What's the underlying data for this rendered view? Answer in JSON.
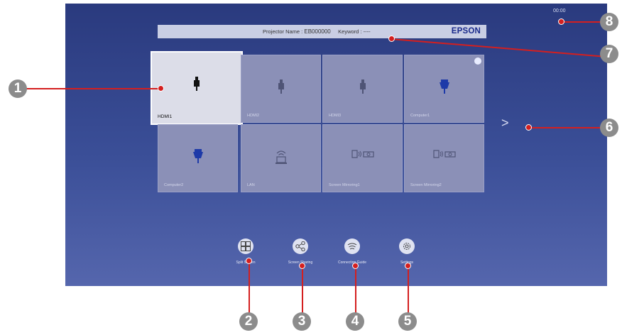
{
  "header": {
    "clock": "00:00",
    "projector_label": "Projector Name :",
    "projector_name": "EB000000",
    "keyword_label": "Keyword :",
    "keyword_value": "----",
    "brand": "EPSON"
  },
  "sources": [
    {
      "label": "HDMI1",
      "icon": "hdmi-icon",
      "selected": true
    },
    {
      "label": "HDMI2",
      "icon": "hdmi-icon"
    },
    {
      "label": "HDMI3",
      "icon": "hdmi-icon"
    },
    {
      "label": "Computer1",
      "icon": "vga-icon",
      "checked": true
    },
    {
      "label": "Computer2",
      "icon": "vga-icon"
    },
    {
      "label": "LAN",
      "icon": "lan-icon"
    },
    {
      "label": "Screen Mirroring1",
      "icon": "mirroring-icon"
    },
    {
      "label": "Screen Mirroring2",
      "icon": "mirroring-icon"
    }
  ],
  "next_arrow": ">",
  "bottom_buttons": [
    {
      "label": "Split Screen",
      "icon": "split-screen-icon"
    },
    {
      "label": "Screen Sharing",
      "icon": "share-icon"
    },
    {
      "label": "Connection Guide",
      "icon": "wifi-icon"
    },
    {
      "label": "Settings",
      "icon": "gear-icon"
    }
  ],
  "callouts": [
    "1",
    "2",
    "3",
    "4",
    "5",
    "6",
    "7",
    "8"
  ],
  "colors": {
    "callout": "#d41f1f",
    "badge": "#8c8c8c",
    "brand": "#1a2a8c"
  }
}
